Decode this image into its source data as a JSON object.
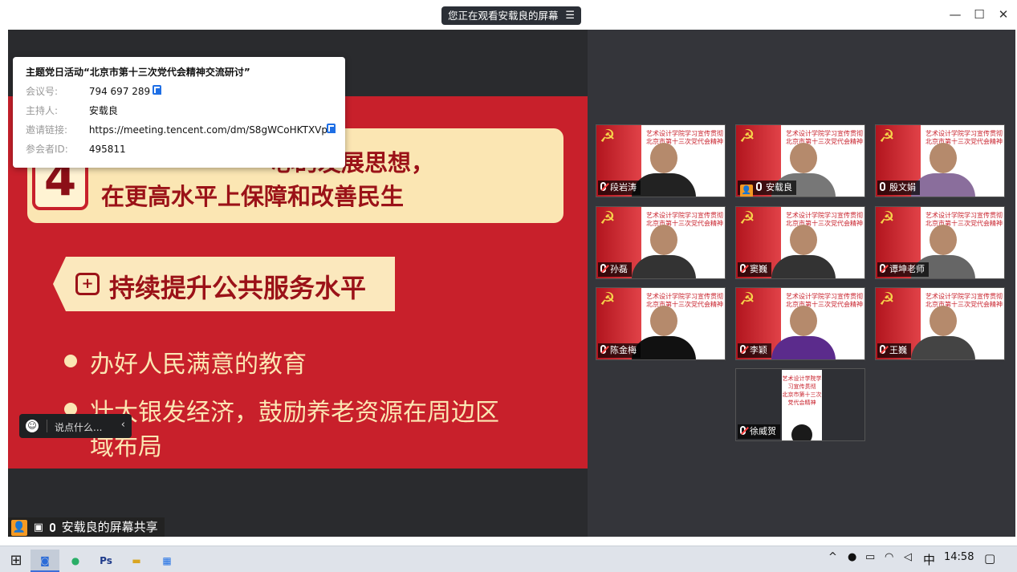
{
  "window": {
    "share_notice": "您正在观看安载良的屏幕",
    "menu_icon": "list-menu-icon",
    "minimize_icon": "minimize-icon",
    "maximize_icon": "maximize-icon",
    "close_icon": "close-icon"
  },
  "meeting_info": {
    "title": "主题党日活动“北京市第十三次党代会精神交流研讨”",
    "meeting_id_label": "会议号:",
    "meeting_id": "794 697 289",
    "host_label": "主持人:",
    "host": "安载良",
    "invite_label": "邀请链接:",
    "invite_link": "https://meeting.tencent.com/dm/S8gWCoHKTXVp",
    "participant_id_label": "参会者ID:",
    "participant_id": "495811"
  },
  "slide": {
    "number": "4",
    "heading_line1": "心的发展思想，",
    "heading_line2": "在更高水平上保障和改善民生",
    "subheading": "持续提升公共服务水平",
    "bullet1": "办好人民满意的教育",
    "bullet2_line1": "壮大银发经济，鼓励养老资源在周边区",
    "bullet2_line2": "域布局"
  },
  "chat": {
    "placeholder": "说点什么...",
    "chevron": "‹"
  },
  "share_label": "安载良的屏幕共享",
  "tile_caption_line1": "艺术设计学院学习宣传贯彻",
  "tile_caption_line2": "北京市第十三次党代会精神",
  "participants": [
    {
      "name": "段岩涛"
    },
    {
      "name": "安载良"
    },
    {
      "name": "殷文娟"
    },
    {
      "name": "孙磊"
    },
    {
      "name": "窦巍"
    },
    {
      "name": "谭坤老师"
    },
    {
      "name": "陈金梅"
    },
    {
      "name": "李颖"
    },
    {
      "name": "王巍"
    },
    {
      "name": "徐威贺"
    }
  ],
  "taskbar": {
    "time": "14:58",
    "ime": "中"
  }
}
